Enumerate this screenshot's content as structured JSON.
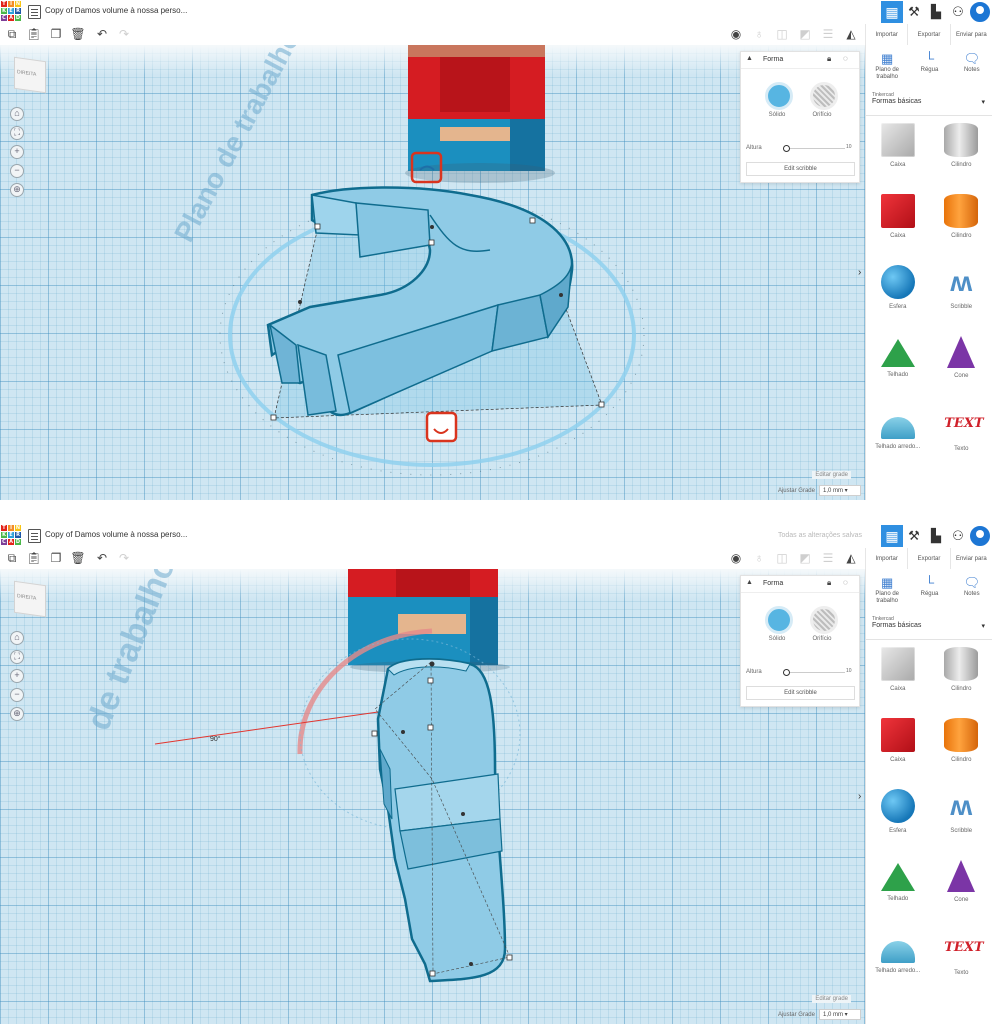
{
  "colors": {
    "accent": "#2f8fe1",
    "shape_fill": "#8fcbe6",
    "shape_stroke": "#0f6c8e",
    "selection_red": "#d9341e"
  },
  "logo": {
    "letters": [
      "T",
      "I",
      "N",
      "K",
      "E",
      "R",
      "C",
      "A",
      "D"
    ],
    "colors": [
      "#e2231a",
      "#f48c25",
      "#f7c415",
      "#4ab749",
      "#2c9fd9",
      "#1e58a8",
      "#7d3f98",
      "#e2231a",
      "#4ab749"
    ]
  },
  "screens": [
    {
      "title": "Copy of Damos volume à nossa perso...",
      "save_status": "",
      "workplane_label": "Plano de trabalho",
      "rotation_readout": "",
      "shape_panel": {
        "title": "Forma",
        "solid": "Sólido",
        "hole": "Orifício",
        "height_label": "Altura",
        "height_value": "10",
        "edit_button": "Edit scribble"
      },
      "footer": {
        "edit_grid": "Editar grade",
        "snap_label": "Ajustar Grade",
        "snap_value": "1,0 mm"
      }
    },
    {
      "title": "Copy of Damos volume à nossa perso...",
      "save_status": "Todas as alterações salvas",
      "workplane_label": "de trabalho",
      "rotation_readout": "90°",
      "shape_panel": {
        "title": "Forma",
        "solid": "Sólido",
        "hole": "Orifício",
        "height_label": "Altura",
        "height_value": "10",
        "edit_button": "Edit scribble"
      },
      "footer": {
        "edit_grid": "Editar grade",
        "snap_label": "Ajustar Grade",
        "snap_value": "1,0 mm"
      }
    }
  ],
  "viewcube_label": "DIREITA",
  "actions": [
    "Importar",
    "Exportar",
    "Enviar para"
  ],
  "library": {
    "tabs": [
      "Plano de trabalho",
      "Régua",
      "Notes"
    ],
    "source": "Tinkercad",
    "category": "Formas básicas",
    "items": [
      "Caixa",
      "Cilindro",
      "Caixa",
      "Cilindro",
      "Esfera",
      "Scribble",
      "Telhado",
      "Cone",
      "Telhado arredo...",
      "Texto"
    ],
    "text_shape_label": "TEXT"
  },
  "icons": {
    "toolbar": [
      "copy-icon",
      "paste-icon",
      "duplicate-icon",
      "delete-icon",
      "undo-icon",
      "redo-icon"
    ],
    "view": [
      "eye-icon",
      "light-bulb-icon",
      "group-icon",
      "ungroup-icon",
      "align-icon",
      "mirror-icon"
    ],
    "top": [
      "grid-view-icon",
      "hammer-icon",
      "blocks-icon",
      "add-user-icon",
      "avatar-icon"
    ]
  }
}
